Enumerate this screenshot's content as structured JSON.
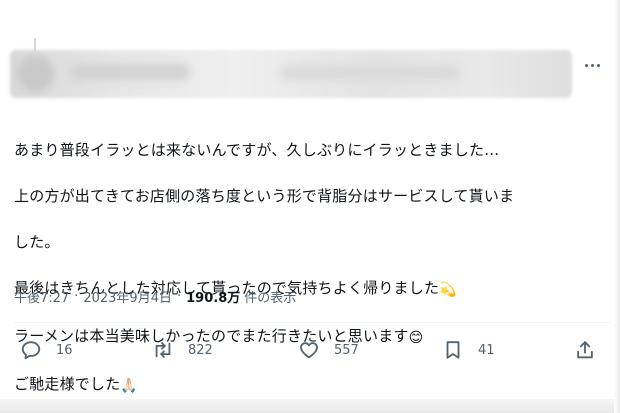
{
  "tweet": {
    "lines": [
      "あまり普段イラッとは来ないんですが、久しぶりにイラッときました…",
      "上の方が出てきてお店側の落ち度という形で背脂分はサービスして貰いま",
      "した。",
      "最後はきちんとした対応して貰ったので気持ちよく帰りました",
      "ラーメンは本当美味しかったのでまた行きたいと思います",
      "ご馳走様でした"
    ],
    "emojis": {
      "line4": "💫",
      "line5": "😊",
      "line6": "🙏🏻"
    }
  },
  "meta": {
    "time": "午後7:27",
    "separator": "·",
    "date": "2023年9月4日",
    "views_count": "190.8万",
    "views_label": "件の表示"
  },
  "actions": {
    "reply_count": "16",
    "retweet_count": "822",
    "like_count": "557",
    "bookmark_count": "41"
  },
  "colors": {
    "text": "#0f1419",
    "secondary": "#536471",
    "divider": "#eff3f4"
  },
  "icons": [
    "more-icon",
    "reply-icon",
    "retweet-icon",
    "like-icon",
    "bookmark-icon",
    "share-icon"
  ]
}
